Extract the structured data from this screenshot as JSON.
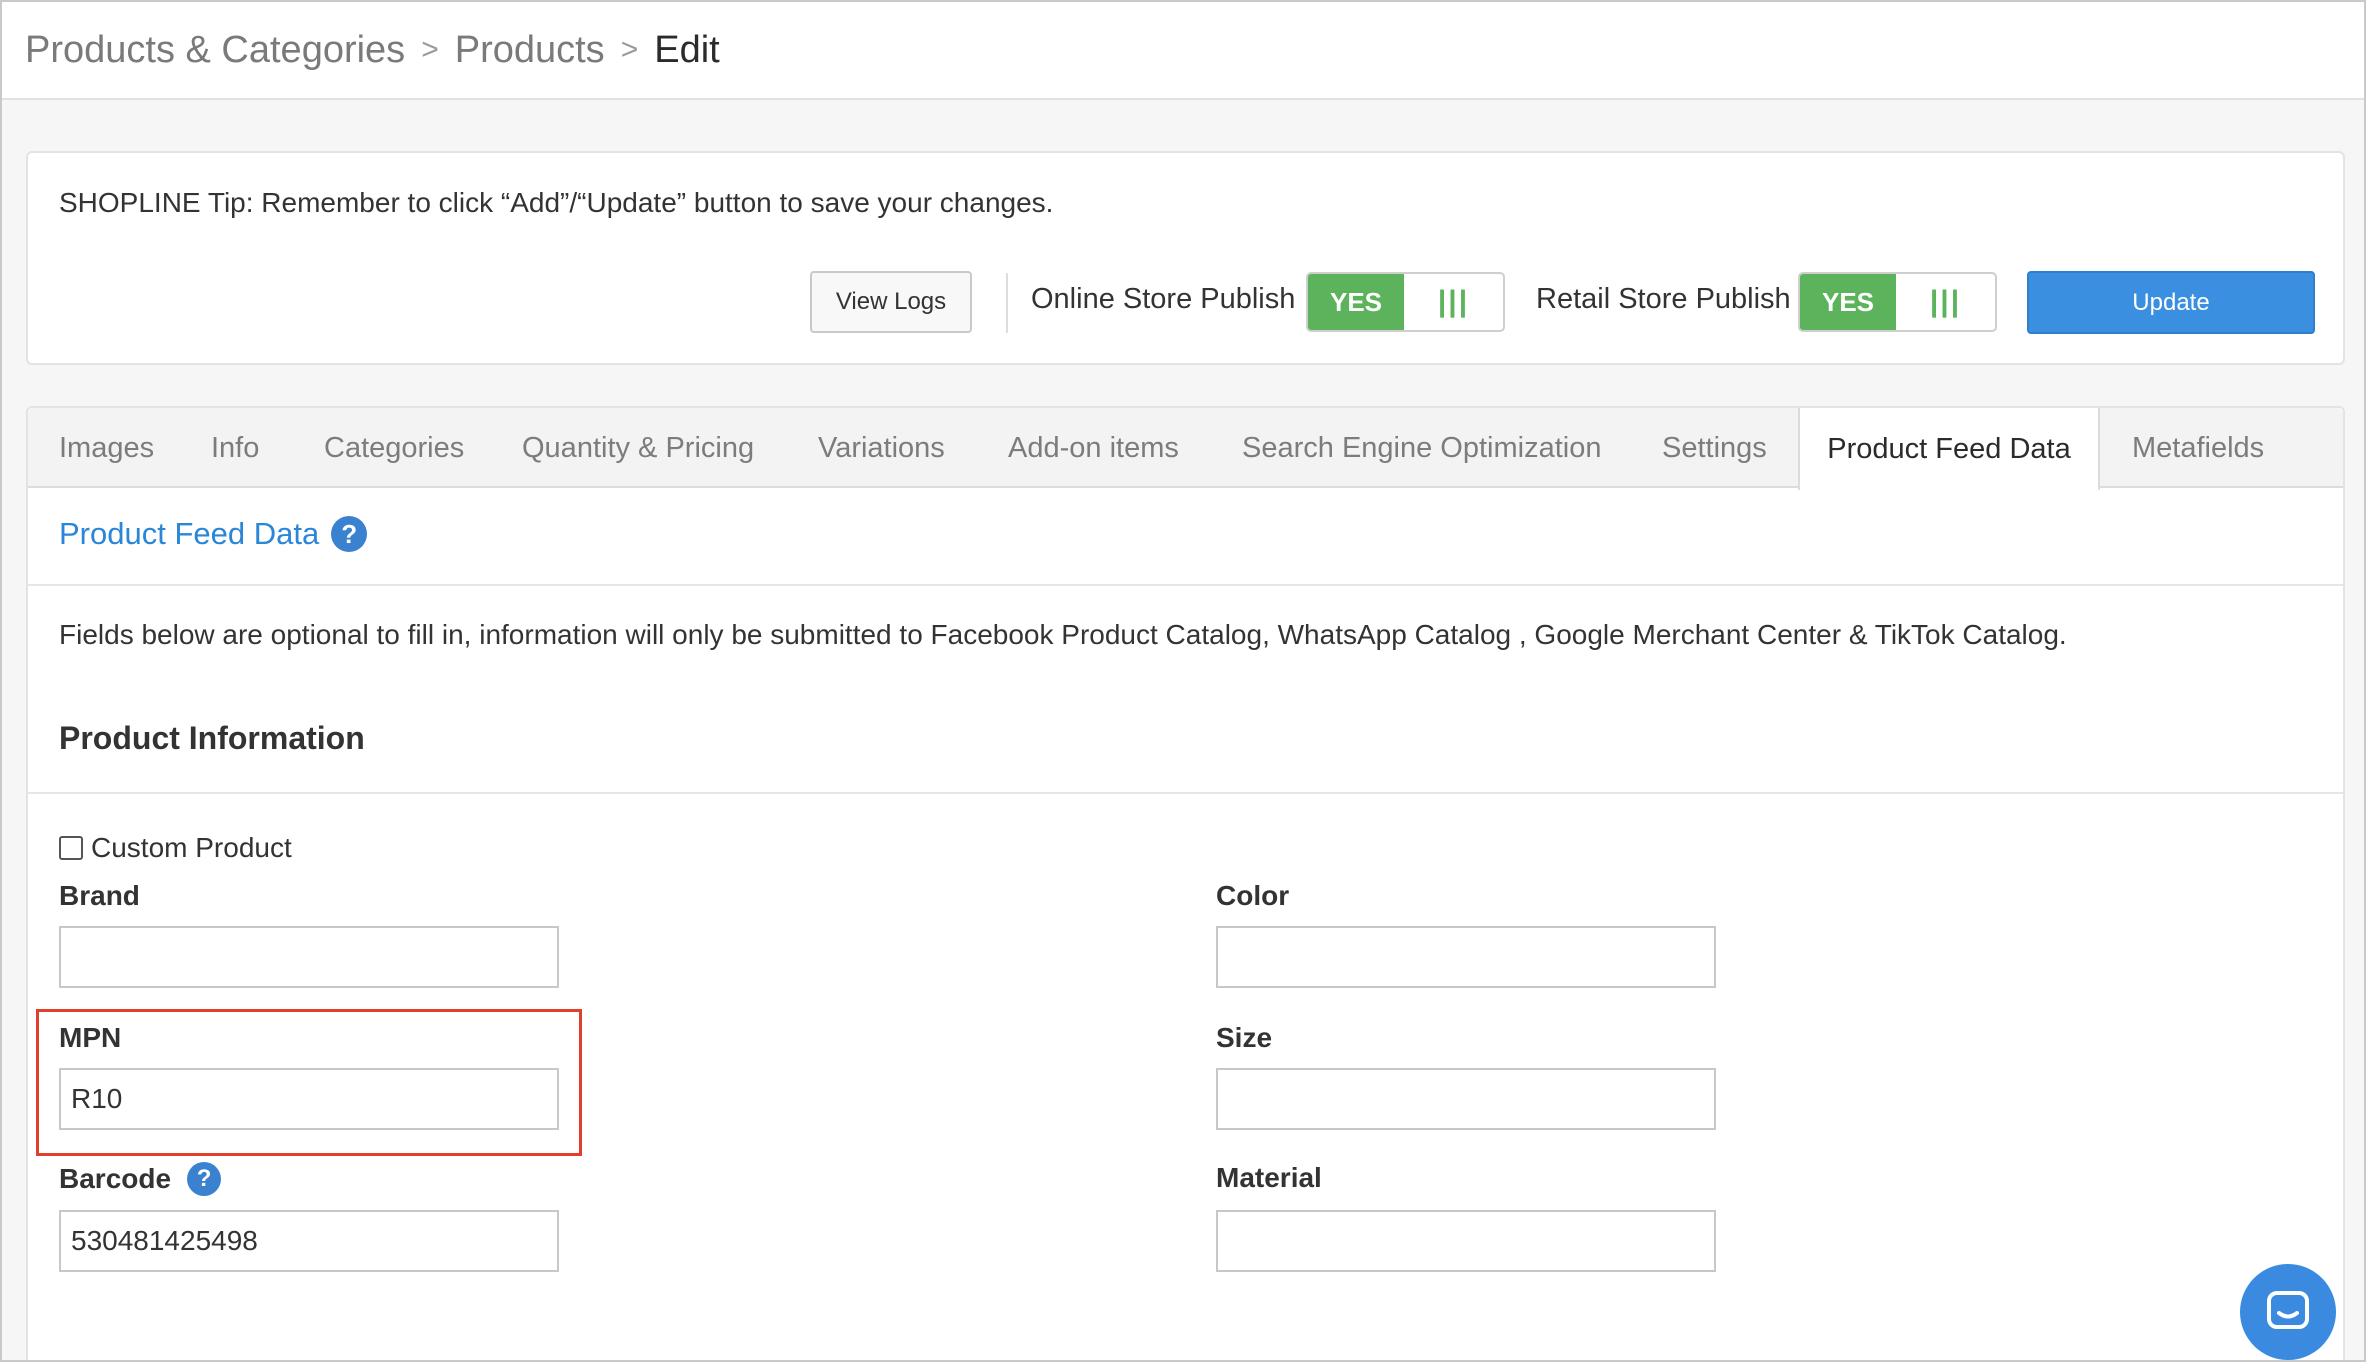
{
  "breadcrumb": {
    "items": [
      "Products & Categories",
      "Products"
    ],
    "current": "Edit",
    "separator": ">"
  },
  "tip": {
    "text": "SHOPLINE Tip: Remember to click “Add”/“Update” button to save your changes."
  },
  "toolbar": {
    "view_logs_label": "View Logs",
    "online_store_label": "Online Store Publish",
    "online_store_value": "YES",
    "retail_store_label": "Retail Store Publish",
    "retail_store_value": "YES",
    "toggle_handle": "|||",
    "update_label": "Update"
  },
  "tabs": [
    {
      "label": "Images"
    },
    {
      "label": "Info"
    },
    {
      "label": "Categories"
    },
    {
      "label": "Quantity & Pricing"
    },
    {
      "label": "Variations"
    },
    {
      "label": "Add-on items"
    },
    {
      "label": "Search Engine Optimization"
    },
    {
      "label": "Settings"
    },
    {
      "label": "Product Feed Data",
      "active": true
    },
    {
      "label": "Metafields"
    }
  ],
  "section": {
    "title": "Product Feed Data",
    "help": "?",
    "description": "Fields below are optional to fill in, information will only be submitted to Facebook Product Catalog, WhatsApp Catalog , Google Merchant Center & TikTok Catalog.",
    "subheading": "Product Information"
  },
  "form": {
    "custom_product_label": "Custom Product",
    "custom_product_checked": false,
    "brand_label": "Brand",
    "brand_value": "",
    "mpn_label": "MPN",
    "mpn_value": "R10",
    "barcode_label": "Barcode",
    "barcode_value": "530481425498",
    "color_label": "Color",
    "color_value": "",
    "size_label": "Size",
    "size_value": "",
    "material_label": "Material",
    "material_value": ""
  },
  "colors": {
    "accent": "#3a8fe0",
    "toggle_green": "#5cb35c",
    "link_blue": "#2a86d6",
    "highlight_red": "#e0402b"
  }
}
